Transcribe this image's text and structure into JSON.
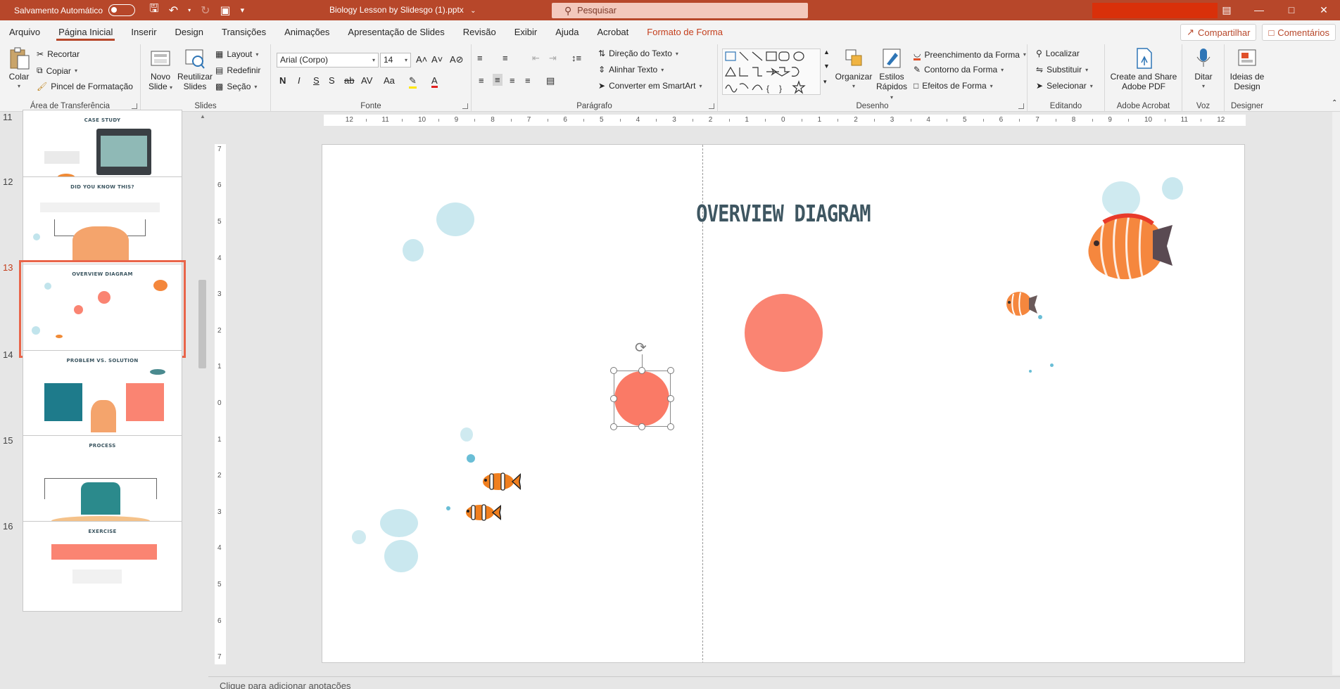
{
  "titlebar": {
    "autosave_label": "Salvamento Automático",
    "filename": "Biology Lesson by Slidesgo (1).pptx",
    "filename_caret": "⌄",
    "search_placeholder": "Pesquisar"
  },
  "menu": {
    "tabs": [
      "Arquivo",
      "Página Inicial",
      "Inserir",
      "Design",
      "Transições",
      "Animações",
      "Apresentação de Slides",
      "Revisão",
      "Exibir",
      "Ajuda",
      "Acrobat",
      "Formato de Forma"
    ],
    "share_label": "Compartilhar",
    "comments_label": "Comentários"
  },
  "ribbon": {
    "clipboard": {
      "label": "Área de Transferência",
      "paste": "Colar",
      "cut": "Recortar",
      "copy": "Copiar",
      "format_painter": "Pincel de Formatação"
    },
    "slides": {
      "label": "Slides",
      "new_slide_1": "Novo",
      "new_slide_2": "Slide",
      "reuse_1": "Reutilizar",
      "reuse_2": "Slides",
      "layout": "Layout",
      "reset": "Redefinir",
      "section": "Seção"
    },
    "font": {
      "label": "Fonte",
      "font_name": "Arial (Corpo)",
      "font_size": "14"
    },
    "paragraph": {
      "label": "Parágrafo",
      "text_direction": "Direção do Texto",
      "align_text": "Alinhar Texto",
      "smartart": "Converter em SmartArt"
    },
    "drawing": {
      "label": "Desenho",
      "arrange": "Organizar",
      "quick_styles_1": "Estilos",
      "quick_styles_2": "Rápidos",
      "fill": "Preenchimento da Forma",
      "outline": "Contorno da Forma",
      "effects": "Efeitos de Forma"
    },
    "editing": {
      "label": "Editando",
      "find": "Localizar",
      "replace": "Substituir",
      "select": "Selecionar"
    },
    "adobe": {
      "label": "Adobe Acrobat",
      "create_1": "Create and Share",
      "create_2": "Adobe PDF"
    },
    "voice": {
      "label": "Voz",
      "dictate": "Ditar"
    },
    "designer": {
      "label": "Designer",
      "ideas_1": "Ideias de",
      "ideas_2": "Design"
    }
  },
  "thumbnails": [
    {
      "num": "11",
      "title": "CASE STUDY"
    },
    {
      "num": "12",
      "title": "DID YOU KNOW THIS?"
    },
    {
      "num": "13",
      "title": "OVERVIEW DIAGRAM"
    },
    {
      "num": "14",
      "title": "PROBLEM VS. SOLUTION"
    },
    {
      "num": "15",
      "title": "PROCESS"
    },
    {
      "num": "16",
      "title": "EXERCISE"
    }
  ],
  "slide": {
    "title": "OVERVIEW DIAGRAM"
  },
  "notes_placeholder": "Clique para adicionar anotações",
  "colors": {
    "accent": "#b7472a",
    "circle": "#fa8472",
    "title": "#3e5661"
  }
}
